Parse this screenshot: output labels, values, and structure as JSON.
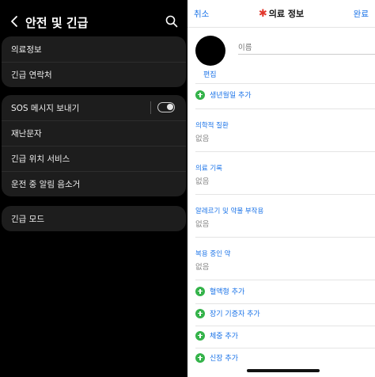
{
  "left": {
    "title": "안전 및 긴급",
    "group1": [
      "의료정보",
      "긴급 연락처"
    ],
    "group2": [
      "SOS 메시지 보내기",
      "재난문자",
      "긴급 위치 서비스",
      "운전 중 알림 음소거"
    ],
    "group3": [
      "긴급 모드"
    ],
    "sos_toggle_on": false
  },
  "right": {
    "cancel": "취소",
    "title": "의료 정보",
    "done": "완료",
    "edit": "편집",
    "name_placeholder": "이름",
    "add_birthday": "생년월일 추가",
    "fields": [
      {
        "label": "의학적 질환",
        "value": "없음"
      },
      {
        "label": "의료 기록",
        "value": "없음"
      },
      {
        "label": "알레르기 및 약물 부작용",
        "value": "없음"
      },
      {
        "label": "복용 중인 약",
        "value": "없음"
      }
    ],
    "adds": [
      "혈액형 추가",
      "장기 기증자 추가",
      "체중 추가",
      "신장 추가"
    ]
  }
}
